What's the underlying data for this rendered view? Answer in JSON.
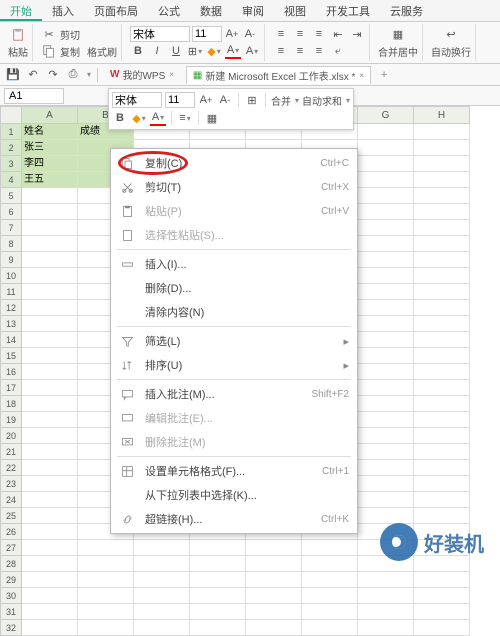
{
  "tabs": [
    "开始",
    "插入",
    "页面布局",
    "公式",
    "数据",
    "审阅",
    "视图",
    "开发工具",
    "云服务"
  ],
  "active_tab": "开始",
  "ribbon": {
    "paste": "粘贴",
    "cut": "剪切",
    "copy": "复制",
    "format_painter": "格式刷",
    "font_name": "宋体",
    "font_size": "11",
    "merge_center": "合并居中",
    "auto_wrap": "自动换行"
  },
  "qat": {
    "mywps": "我的WPS",
    "doc_name": "新建 Microsoft Excel 工作表.xlsx *"
  },
  "namebox": "A1",
  "mini": {
    "font": "宋体",
    "size": "11",
    "merge": "合并",
    "autosum": "自动求和"
  },
  "columns": [
    "A",
    "B",
    "C",
    "D",
    "E",
    "F",
    "G",
    "H"
  ],
  "data": {
    "A1": "姓名",
    "B1": "成绩",
    "A2": "张三",
    "A3": "李四",
    "A4": "王五"
  },
  "context_menu": [
    {
      "icon": "copy",
      "label": "复制(C)",
      "shortcut": "Ctrl+C",
      "enabled": true
    },
    {
      "icon": "cut",
      "label": "剪切(T)",
      "shortcut": "Ctrl+X",
      "enabled": true
    },
    {
      "icon": "paste",
      "label": "粘贴(P)",
      "shortcut": "Ctrl+V",
      "enabled": false
    },
    {
      "icon": "paste-special",
      "label": "选择性粘贴(S)...",
      "shortcut": "",
      "enabled": false
    },
    {
      "sep": true
    },
    {
      "icon": "insert",
      "label": "插入(I)...",
      "shortcut": "",
      "enabled": true
    },
    {
      "icon": "",
      "label": "删除(D)...",
      "shortcut": "",
      "enabled": true
    },
    {
      "icon": "",
      "label": "清除内容(N)",
      "shortcut": "",
      "enabled": true
    },
    {
      "sep": true
    },
    {
      "icon": "filter",
      "label": "筛选(L)",
      "shortcut": "",
      "enabled": true,
      "sub": true
    },
    {
      "icon": "sort",
      "label": "排序(U)",
      "shortcut": "",
      "enabled": true,
      "sub": true
    },
    {
      "sep": true
    },
    {
      "icon": "comment",
      "label": "插入批注(M)...",
      "shortcut": "Shift+F2",
      "enabled": true
    },
    {
      "icon": "comment-edit",
      "label": "编辑批注(E)...",
      "shortcut": "",
      "enabled": false
    },
    {
      "icon": "comment-del",
      "label": "删除批注(M)",
      "shortcut": "",
      "enabled": false
    },
    {
      "sep": true
    },
    {
      "icon": "format",
      "label": "设置单元格格式(F)...",
      "shortcut": "Ctrl+1",
      "enabled": true
    },
    {
      "icon": "",
      "label": "从下拉列表中选择(K)...",
      "shortcut": "",
      "enabled": true
    },
    {
      "icon": "link",
      "label": "超链接(H)...",
      "shortcut": "Ctrl+K",
      "enabled": true
    }
  ],
  "watermark": "好装机"
}
